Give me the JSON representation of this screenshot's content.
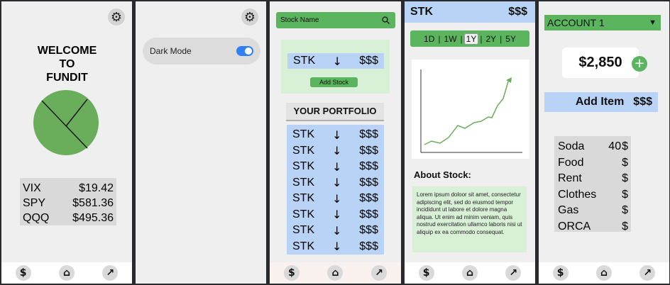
{
  "nav": {
    "icons": [
      {
        "name": "dollar-icon",
        "glyph": "$"
      },
      {
        "name": "home-icon",
        "glyph": "⌂"
      },
      {
        "name": "trend-up-icon",
        "glyph": "↗"
      }
    ]
  },
  "home": {
    "settings_icon": "gear-icon",
    "welcome_line1": "WELCOME",
    "welcome_line2": "TO",
    "welcome_line3": "FUNDIT",
    "indices": [
      {
        "symbol": "VIX",
        "price": "$19.42"
      },
      {
        "symbol": "SPY",
        "price": "$581.36"
      },
      {
        "symbol": "QQQ",
        "price": "$495.36"
      }
    ]
  },
  "settings": {
    "settings_icon": "gear-icon",
    "dark_mode_label": "Dark Mode",
    "dark_mode_on": true
  },
  "stocks": {
    "search_placeholder": "Stock Name",
    "new_row": {
      "ticker": "STK",
      "arrow": "↓",
      "price": "$$$"
    },
    "add_button": "Add Stock",
    "portfolio_title": "YOUR PORTFOLIO",
    "portfolio": [
      {
        "ticker": "STK",
        "arrow": "↓",
        "price": "$$$"
      },
      {
        "ticker": "STK",
        "arrow": "↓",
        "price": "$$$"
      },
      {
        "ticker": "STK",
        "arrow": "↓",
        "price": "$$$"
      },
      {
        "ticker": "STK",
        "arrow": "↓",
        "price": "$$$"
      },
      {
        "ticker": "STK",
        "arrow": "↓",
        "price": "$$$"
      },
      {
        "ticker": "STK",
        "arrow": "↓",
        "price": "$$$"
      },
      {
        "ticker": "STK",
        "arrow": "↓",
        "price": "$$$"
      },
      {
        "ticker": "STK",
        "arrow": "↓",
        "price": "$$$"
      }
    ]
  },
  "detail": {
    "ticker": "STK",
    "price": "$$$",
    "ranges": [
      "1D",
      "1W",
      "1Y",
      "2Y",
      "5Y"
    ],
    "selected_range": "1Y",
    "about_title": "About Stock:",
    "about_text": "Lorem ipsum doloor sit amet, consectetur adipiscing elit, sed do eiusmod tempor incididunt ut labore et dolore magna aliqua. Ut enim ad minim veniam, quis nostrud exercitation ullamco laboris nisi ut aliquip ex ea commodo consequat."
  },
  "budget": {
    "account_label": "ACCOUNT 1",
    "balance": "$2,850",
    "add_item_label": "Add Item",
    "add_item_amount": "$$$",
    "items": [
      {
        "label": "Soda",
        "amount": "40",
        "currency": "$"
      },
      {
        "label": "Food",
        "amount": "",
        "currency": "$"
      },
      {
        "label": "Rent",
        "amount": "",
        "currency": "$"
      },
      {
        "label": "Clothes",
        "amount": "",
        "currency": "$"
      },
      {
        "label": "Gas",
        "amount": "",
        "currency": "$"
      },
      {
        "label": "ORCA",
        "amount": "",
        "currency": "$"
      }
    ]
  },
  "colors": {
    "green": "#5bb55e",
    "light_green": "#d8f0d6",
    "blue": "#b8d3f5",
    "toggle_blue": "#2f7ff6"
  }
}
